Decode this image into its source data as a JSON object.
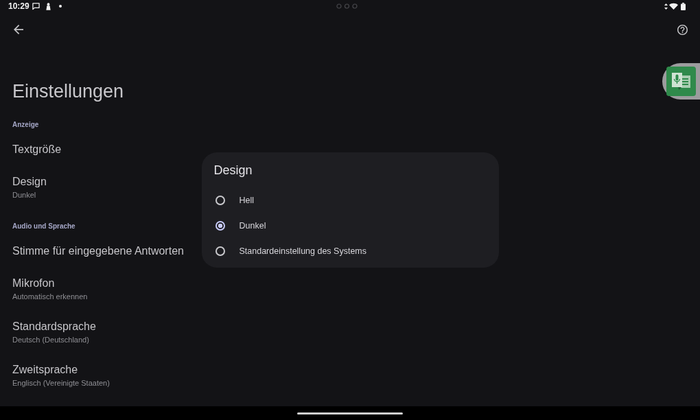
{
  "status_bar": {
    "time": "10:29"
  },
  "page": {
    "title": "Einstellungen"
  },
  "sections": [
    {
      "header": "Anzeige",
      "items": [
        {
          "title": "Textgröße"
        },
        {
          "title": "Design",
          "summary": "Dunkel"
        }
      ]
    },
    {
      "header": "Audio und Sprache",
      "items": [
        {
          "title": "Stimme für eingegebene Antworten"
        },
        {
          "title": "Mikrofon",
          "summary": "Automatisch erkennen"
        },
        {
          "title": "Standardsprache",
          "summary": "Deutsch (Deutschland)"
        },
        {
          "title": "Zweitsprache",
          "summary": "Englisch (Vereinigte Staaten)"
        }
      ]
    }
  ],
  "dialog": {
    "title": "Design",
    "options": [
      {
        "label": "Hell",
        "selected": false
      },
      {
        "label": "Dunkel",
        "selected": true
      },
      {
        "label": "Standardeinstellung des Systems",
        "selected": false
      }
    ]
  }
}
